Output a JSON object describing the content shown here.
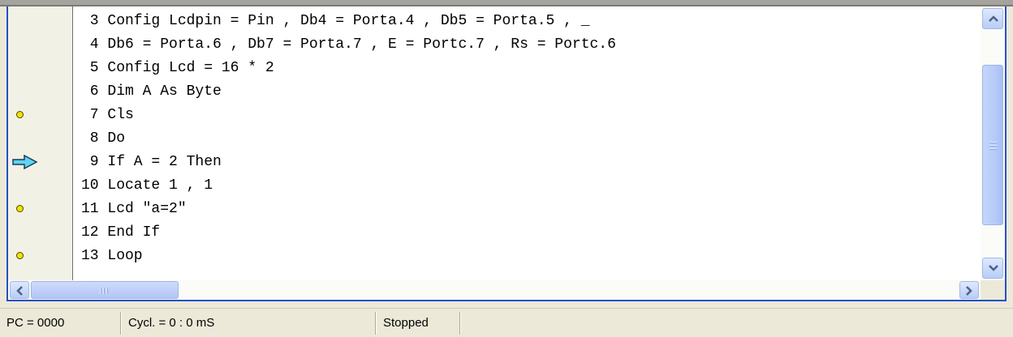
{
  "editor": {
    "lines": [
      {
        "text": " 3 Config Lcdpin = Pin , Db4 = Porta.4 , Db5 = Porta.5 , _",
        "marker": "none"
      },
      {
        "text": " 4 Db6 = Porta.6 , Db7 = Porta.7 , E = Portc.7 , Rs = Portc.6",
        "marker": "none"
      },
      {
        "text": " 5 Config Lcd = 16 * 2",
        "marker": "none"
      },
      {
        "text": " 6 Dim A As Byte",
        "marker": "none"
      },
      {
        "text": " 7 Cls",
        "marker": "breakpoint"
      },
      {
        "text": " 8 Do",
        "marker": "none"
      },
      {
        "text": " 9 If A = 2 Then",
        "marker": "current"
      },
      {
        "text": "10 Locate 1 , 1",
        "marker": "none"
      },
      {
        "text": "11 Lcd \"a=2\"",
        "marker": "breakpoint"
      },
      {
        "text": "12 End If",
        "marker": "none"
      },
      {
        "text": "13 Loop",
        "marker": "breakpoint"
      }
    ],
    "marker_icons": {
      "breakpoint": "breakpoint-dot-icon",
      "current": "current-line-arrow-icon"
    },
    "colors": {
      "breakpoint_fill": "#f5e000",
      "arrow_fill": "#5fd4f0",
      "scrollbar_blue": "#b8cdf7"
    }
  },
  "statusbar": {
    "pc": "PC = 0000",
    "cycles": "Cycl. = 0 : 0 mS",
    "state": "Stopped"
  }
}
